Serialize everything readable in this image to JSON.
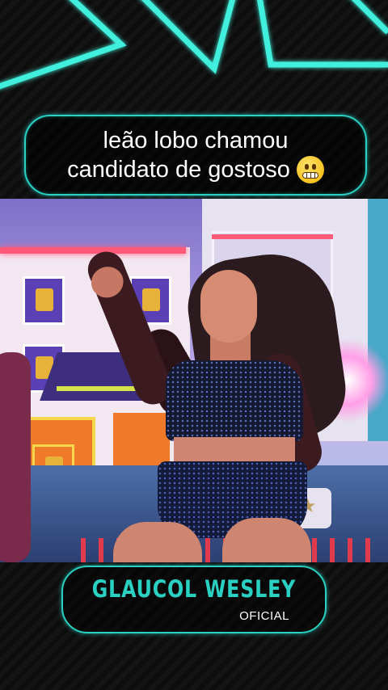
{
  "caption": {
    "line1": "leão lobo chamou",
    "line2": "candidato de gostoso",
    "emoji": "grimacing-face"
  },
  "video": {
    "description_icon": "dancer-video-frame"
  },
  "brand": {
    "name": "GLAUCOL WESLEY",
    "subtitle": "OFICIAL"
  },
  "colors": {
    "accent": "#2ad1c3",
    "background": "#111111",
    "text": "#ffffff"
  }
}
